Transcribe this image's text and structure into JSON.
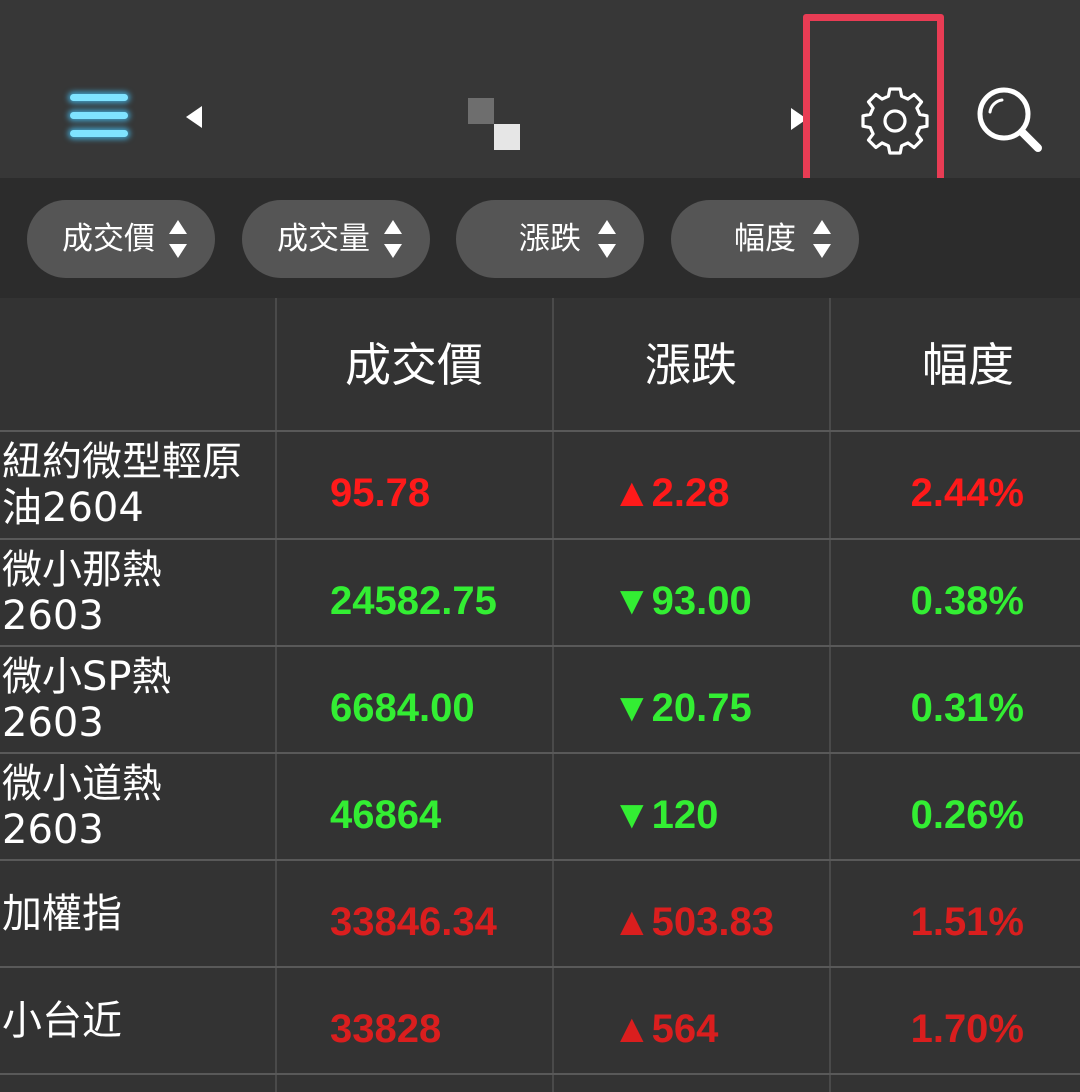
{
  "toolbar": {
    "menu_icon": "hamburger-menu-icon",
    "prev_icon": "arrow-left-icon",
    "next_icon": "arrow-right-icon",
    "settings_icon": "gear-icon",
    "search_icon": "magnifier-icon",
    "highlight_color": "#e83c54"
  },
  "sort_chips": [
    {
      "label": "成交價",
      "icon": "sort-updown-icon"
    },
    {
      "label": "成交量",
      "icon": "sort-updown-icon"
    },
    {
      "label": "漲跌",
      "icon": "sort-updown-icon"
    },
    {
      "label": "幅度",
      "icon": "sort-updown-icon"
    }
  ],
  "table": {
    "headers": {
      "name": "",
      "price": "成交價",
      "change": "漲跌",
      "pct": "幅度"
    },
    "rows": [
      {
        "name_line1": "紐約微型輕原",
        "name_line2": "油2604",
        "price": "95.78",
        "change": "▲2.28",
        "pct": "2.44%",
        "direction": "up"
      },
      {
        "name_line1": "微小那熱",
        "name_line2": "2603",
        "price": "24582.75",
        "change": "▼93.00",
        "pct": "0.38%",
        "direction": "down"
      },
      {
        "name_line1": "微小SP熱",
        "name_line2": "2603",
        "price": "6684.00",
        "change": "▼20.75",
        "pct": "0.31%",
        "direction": "down"
      },
      {
        "name_line1": "微小道熱",
        "name_line2": "2603",
        "price": "46864",
        "change": "▼120",
        "pct": "0.26%",
        "direction": "down"
      },
      {
        "name_line1": "加權指",
        "name_line2": "",
        "price": "33846.34",
        "change": "▲503.83",
        "pct": "1.51%",
        "direction": "up"
      },
      {
        "name_line1": "小台近",
        "name_line2": "",
        "price": "33828",
        "change": "▲564",
        "pct": "1.70%",
        "direction": "up"
      }
    ]
  },
  "colors": {
    "up": "#ff1a1a",
    "down": "#33ee33",
    "background": "#333333"
  }
}
